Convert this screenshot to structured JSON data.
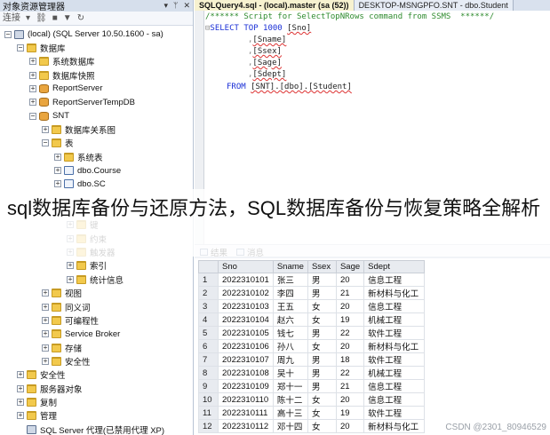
{
  "object_explorer": {
    "title": "对象资源管理器",
    "title_buttons": [
      "▾",
      "ᛘ",
      "✕"
    ],
    "toolbar_label": "连接",
    "toolbar_icons": [
      "connect-icon",
      "filter-icon",
      "refresh-icon",
      "stop-icon"
    ],
    "tree": [
      {
        "label": "(local) (SQL Server 10.50.1600 - sa)",
        "indent": 0,
        "exp": "−",
        "icon": "server"
      },
      {
        "label": "数据库",
        "indent": 1,
        "exp": "−",
        "icon": "folder"
      },
      {
        "label": "系统数据库",
        "indent": 2,
        "exp": "+",
        "icon": "folder"
      },
      {
        "label": "数据库快照",
        "indent": 2,
        "exp": "+",
        "icon": "folder"
      },
      {
        "label": "ReportServer",
        "indent": 2,
        "exp": "+",
        "icon": "db"
      },
      {
        "label": "ReportServerTempDB",
        "indent": 2,
        "exp": "+",
        "icon": "db"
      },
      {
        "label": "SNT",
        "indent": 2,
        "exp": "−",
        "icon": "db"
      },
      {
        "label": "数据库关系图",
        "indent": 3,
        "exp": "+",
        "icon": "folder"
      },
      {
        "label": "表",
        "indent": 3,
        "exp": "−",
        "icon": "folder"
      },
      {
        "label": "系统表",
        "indent": 4,
        "exp": "+",
        "icon": "folder"
      },
      {
        "label": "dbo.Course",
        "indent": 4,
        "exp": "+",
        "icon": "table"
      },
      {
        "label": "dbo.SC",
        "indent": 4,
        "exp": "+",
        "icon": "table"
      },
      {
        "label": "",
        "indent": 4,
        "exp": "",
        "icon": ""
      },
      {
        "label": "",
        "indent": 5,
        "exp": "",
        "icon": ""
      },
      {
        "label": "键",
        "indent": 5,
        "exp": "+",
        "icon": "folder"
      },
      {
        "label": "约束",
        "indent": 5,
        "exp": "+",
        "icon": "folder"
      },
      {
        "label": "触发器",
        "indent": 5,
        "exp": "+",
        "icon": "folder"
      },
      {
        "label": "索引",
        "indent": 5,
        "exp": "+",
        "icon": "folder"
      },
      {
        "label": "统计信息",
        "indent": 5,
        "exp": "+",
        "icon": "folder"
      },
      {
        "label": "视图",
        "indent": 3,
        "exp": "+",
        "icon": "folder"
      },
      {
        "label": "同义词",
        "indent": 3,
        "exp": "+",
        "icon": "folder"
      },
      {
        "label": "可编程性",
        "indent": 3,
        "exp": "+",
        "icon": "folder"
      },
      {
        "label": "Service Broker",
        "indent": 3,
        "exp": "+",
        "icon": "folder"
      },
      {
        "label": "存储",
        "indent": 3,
        "exp": "+",
        "icon": "folder"
      },
      {
        "label": "安全性",
        "indent": 3,
        "exp": "+",
        "icon": "folder"
      },
      {
        "label": "安全性",
        "indent": 1,
        "exp": "+",
        "icon": "folder"
      },
      {
        "label": "服务器对象",
        "indent": 1,
        "exp": "+",
        "icon": "folder"
      },
      {
        "label": "复制",
        "indent": 1,
        "exp": "+",
        "icon": "folder"
      },
      {
        "label": "管理",
        "indent": 1,
        "exp": "+",
        "icon": "folder"
      },
      {
        "label": "SQL Server 代理(已禁用代理 XP)",
        "indent": 1,
        "exp": "",
        "icon": "server"
      }
    ]
  },
  "tabs": [
    {
      "label": "SQLQuery4.sql - (local).master (sa (52))",
      "active": true
    },
    {
      "label": "DESKTOP-MSNGPFO.SNT - dbo.Student",
      "active": false
    }
  ],
  "editor": {
    "comment": "/****** Script for SelectTopNRows command from SSMS  ******/",
    "select_kw": "SELECT TOP 1000",
    "first_col": "[Sno]",
    "columns": [
      "[Sname]",
      "[Ssex]",
      "[Sage]",
      "[Sdept]"
    ],
    "from_kw": "FROM",
    "from_table": "[SNT].[dbo].[Student]"
  },
  "results": {
    "tab_results": "结果",
    "tab_messages": "消息",
    "headers": [
      "Sno",
      "Sname",
      "Ssex",
      "Sage",
      "Sdept"
    ],
    "rows": [
      [
        "1",
        "2022310101",
        "张三",
        "男",
        "20",
        "信息工程"
      ],
      [
        "2",
        "2022310102",
        "李四",
        "男",
        "21",
        "新材料与化工"
      ],
      [
        "3",
        "2022310103",
        "王五",
        "女",
        "20",
        "信息工程"
      ],
      [
        "4",
        "2022310104",
        "赵六",
        "女",
        "19",
        "机械工程"
      ],
      [
        "5",
        "2022310105",
        "钱七",
        "男",
        "22",
        "软件工程"
      ],
      [
        "6",
        "2022310106",
        "孙八",
        "女",
        "20",
        "新材料与化工"
      ],
      [
        "7",
        "2022310107",
        "周九",
        "男",
        "18",
        "软件工程"
      ],
      [
        "8",
        "2022310108",
        "吴十",
        "男",
        "22",
        "机械工程"
      ],
      [
        "9",
        "2022310109",
        "郑十一",
        "男",
        "21",
        "信息工程"
      ],
      [
        "10",
        "2022310110",
        "陈十二",
        "女",
        "20",
        "信息工程"
      ],
      [
        "11",
        "2022310111",
        "高十三",
        "女",
        "19",
        "软件工程"
      ],
      [
        "12",
        "2022310112",
        "邓十四",
        "女",
        "20",
        "新材料与化工"
      ]
    ]
  },
  "overlay_title": "sql数据库备份与还原方法，SQL数据库备份与恢复策略全解析",
  "watermark": "CSDN @2301_80946529"
}
